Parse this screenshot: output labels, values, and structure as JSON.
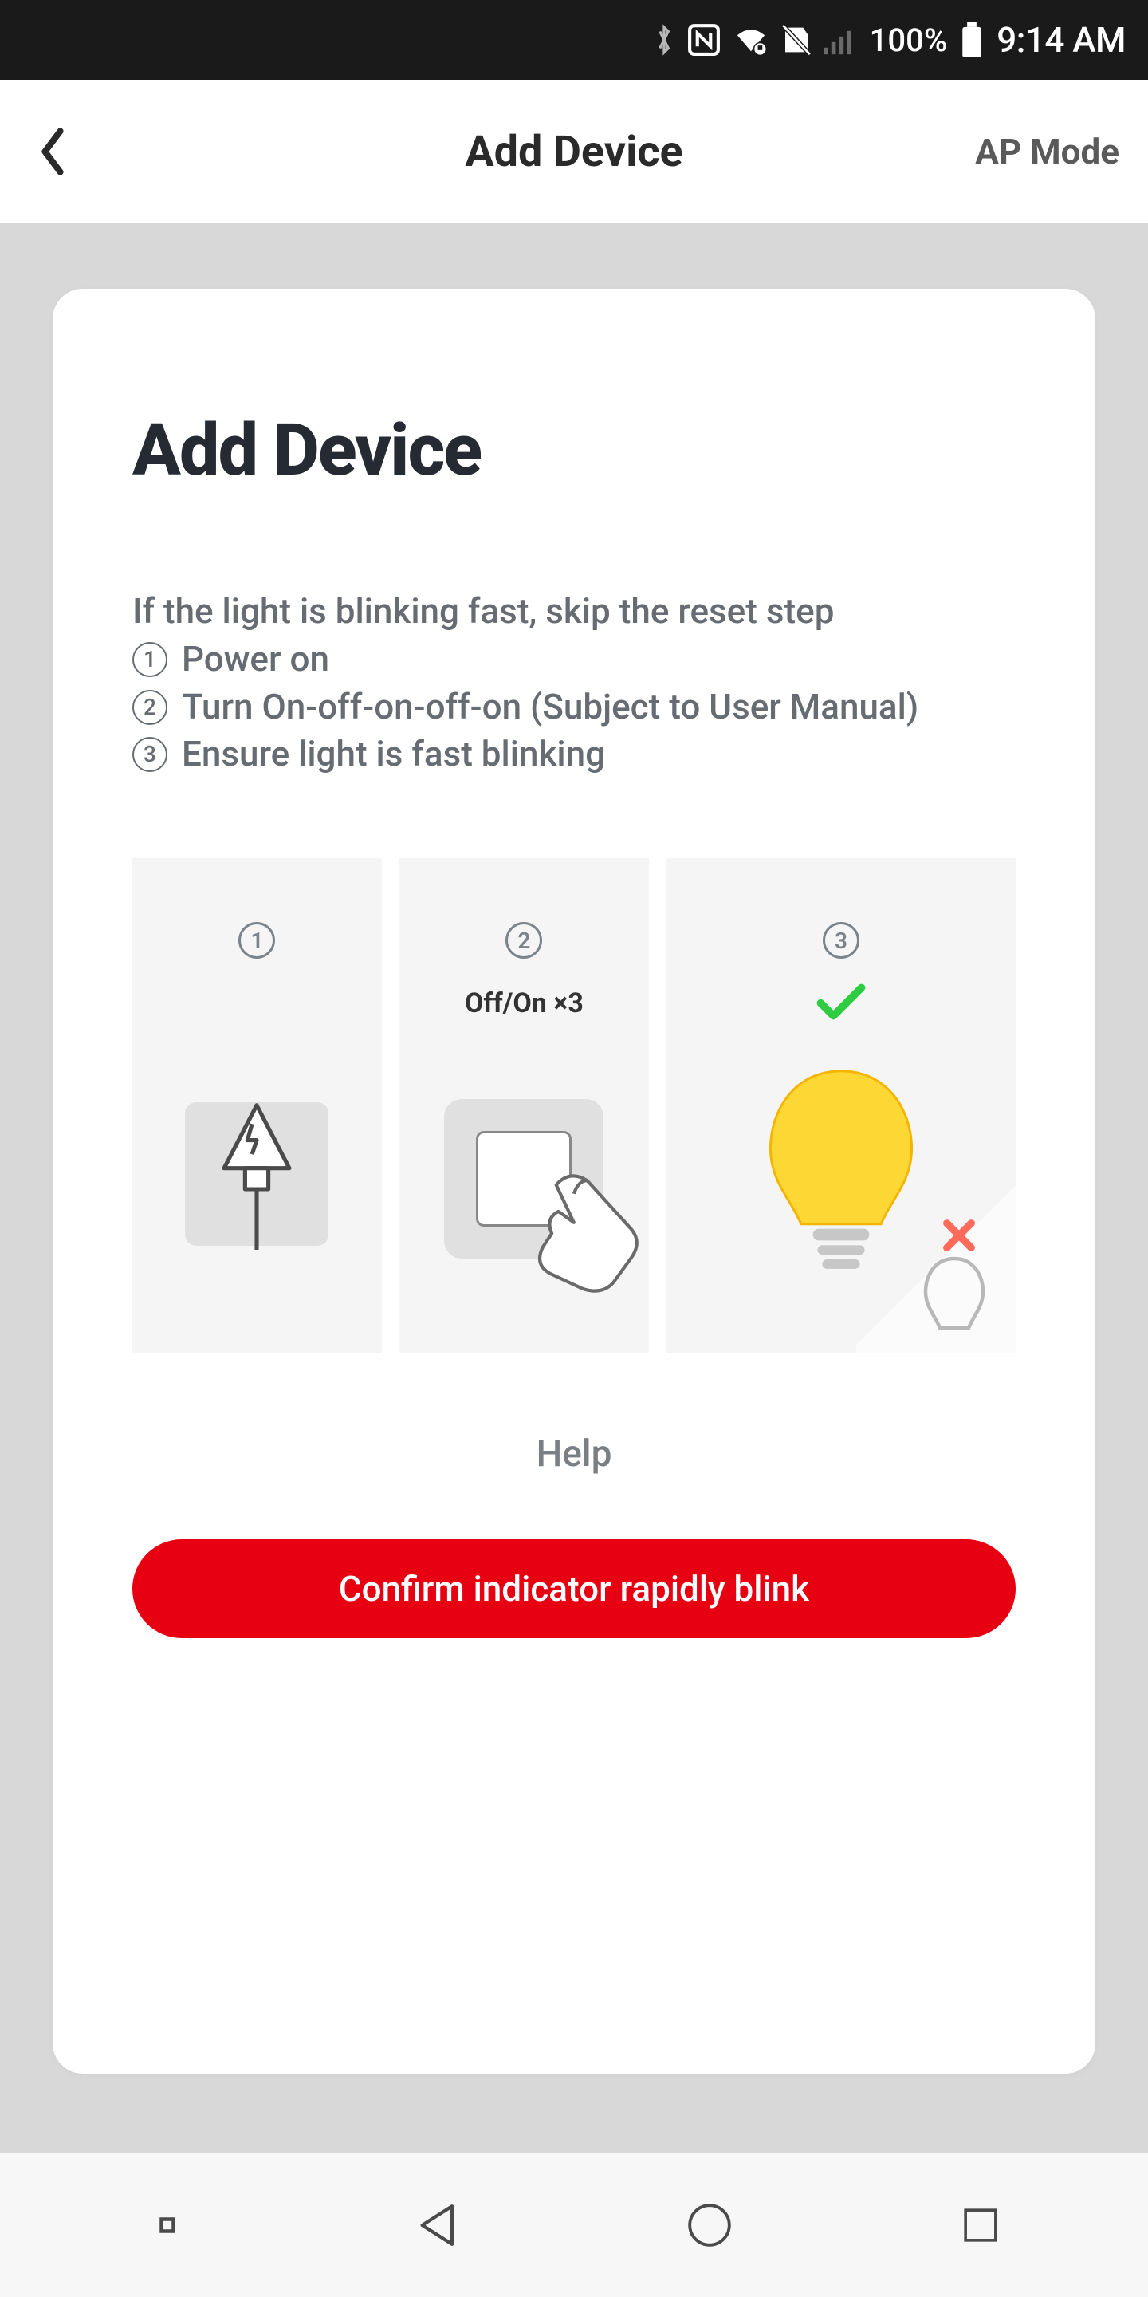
{
  "status": {
    "battery": "100%",
    "time": "9:14 AM"
  },
  "header": {
    "title": "Add Device",
    "mode": "AP Mode"
  },
  "card": {
    "title": "Add Device",
    "intro": "If the light is blinking fast, skip the reset step",
    "steps": [
      "Power on",
      "Turn On-off-on-off-on (Subject to User Manual)",
      "Ensure light is fast blinking"
    ],
    "panel2_sub": "Off/On ×3",
    "help": "Help",
    "confirm": "Confirm indicator rapidly blink"
  }
}
